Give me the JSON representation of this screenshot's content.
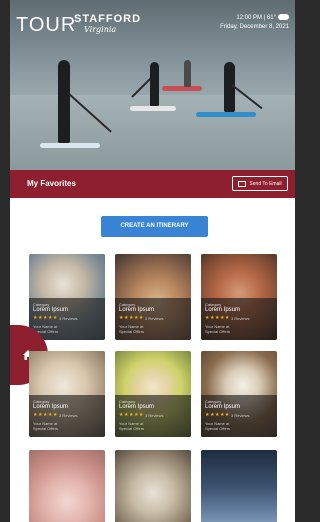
{
  "header": {
    "logo_tour": "TOUR",
    "logo_stafford": "STAFFORD",
    "logo_virginia": "Virginia",
    "time_line": "12:00 PM | 61°",
    "date_line": "Friday, December 8, 2021",
    "weather_icon": "cloud-icon"
  },
  "favorites": {
    "title": "My Favorites",
    "send_label": "Send To Email"
  },
  "create_button": "CREATE AN ITINERARY",
  "cards": [
    {
      "category": "Category",
      "title": "Lorem Ipsum",
      "stars": "★★★★★",
      "reviews": "3 Reviews",
      "line1": "Your Name at",
      "line2": "Special Offers"
    },
    {
      "category": "Category",
      "title": "Lorem Ipsum",
      "stars": "★★★★★",
      "reviews": "3 Reviews",
      "line1": "Your Name at",
      "line2": "Special Offers"
    },
    {
      "category": "Category",
      "title": "Lorem Ipsum",
      "stars": "★★★★★",
      "reviews": "3 Reviews",
      "line1": "Your Name at",
      "line2": "Special Offers"
    },
    {
      "category": "Category",
      "title": "Lorem Ipsum",
      "stars": "★★★★★",
      "reviews": "3 Reviews",
      "line1": "Your Name at",
      "line2": "Special Offers"
    },
    {
      "category": "Category",
      "title": "Lorem Ipsum",
      "stars": "★★★★★",
      "reviews": "3 Reviews",
      "line1": "Your Name at",
      "line2": "Special Offers"
    },
    {
      "category": "Category",
      "title": "Lorem Ipsum",
      "stars": "★★★★★",
      "reviews": "3 Reviews",
      "line1": "Your Name at",
      "line2": "Special Offers"
    }
  ],
  "home_icon": "home-icon",
  "colors": {
    "brand": "#8d1f2e",
    "button": "#3a84d6",
    "star": "#f2b01e"
  }
}
